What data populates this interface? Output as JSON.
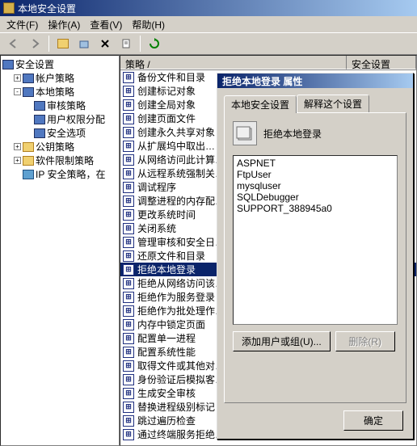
{
  "window": {
    "title": "本地安全设置"
  },
  "menu": {
    "file": "文件(F)",
    "action": "操作(A)",
    "view": "查看(V)",
    "help": "帮助(H)"
  },
  "tree": {
    "root": "安全设置",
    "nodes": [
      {
        "label": "帐户策略",
        "expander": "+",
        "level": 1,
        "icon": "book"
      },
      {
        "label": "本地策略",
        "expander": "-",
        "level": 1,
        "icon": "book"
      },
      {
        "label": "审核策略",
        "expander": "",
        "level": 2,
        "icon": "book"
      },
      {
        "label": "用户权限分配",
        "expander": "",
        "level": 2,
        "icon": "book"
      },
      {
        "label": "安全选项",
        "expander": "",
        "level": 2,
        "icon": "book"
      },
      {
        "label": "公钥策略",
        "expander": "+",
        "level": 1,
        "icon": "folder"
      },
      {
        "label": "软件限制策略",
        "expander": "+",
        "level": 1,
        "icon": "folder"
      },
      {
        "label": "IP 安全策略，在",
        "expander": "",
        "level": 1,
        "icon": "ip"
      }
    ]
  },
  "list": {
    "col1": "策略  /",
    "col2": "安全设置",
    "items": [
      "备份文件和目录",
      "创建标记对象",
      "创建全局对象",
      "创建页面文件",
      "创建永久共享对象",
      "从扩展坞中取出…",
      "从网络访问此计算…",
      "从远程系统强制关…",
      "调试程序",
      "调整进程的内存配…",
      "更改系统时间",
      "关闭系统",
      "管理审核和安全日…",
      "还原文件和目录",
      "拒绝本地登录",
      "拒绝从网络访问该…",
      "拒绝作为服务登录",
      "拒绝作为批处理作…",
      "内存中锁定页面",
      "配置单一进程",
      "配置系统性能",
      "取得文件或其他对…",
      "身份验证后模拟客…",
      "生成安全审核",
      "替换进程级别标记",
      "跳过遍历检查",
      "通过终端服务拒绝…"
    ],
    "selected": 14
  },
  "dialog": {
    "title": "拒绝本地登录 属性",
    "tab_active": "本地安全设置",
    "tab_other": "解释这个设置",
    "policy_label": "拒绝本地登录",
    "users": [
      "ASPNET",
      "FtpUser",
      "mysqluser",
      "SQLDebugger",
      "SUPPORT_388945a0"
    ],
    "btn_add": "添加用户或组(U)...",
    "btn_del": "删除(R)",
    "btn_ok": "确定"
  }
}
